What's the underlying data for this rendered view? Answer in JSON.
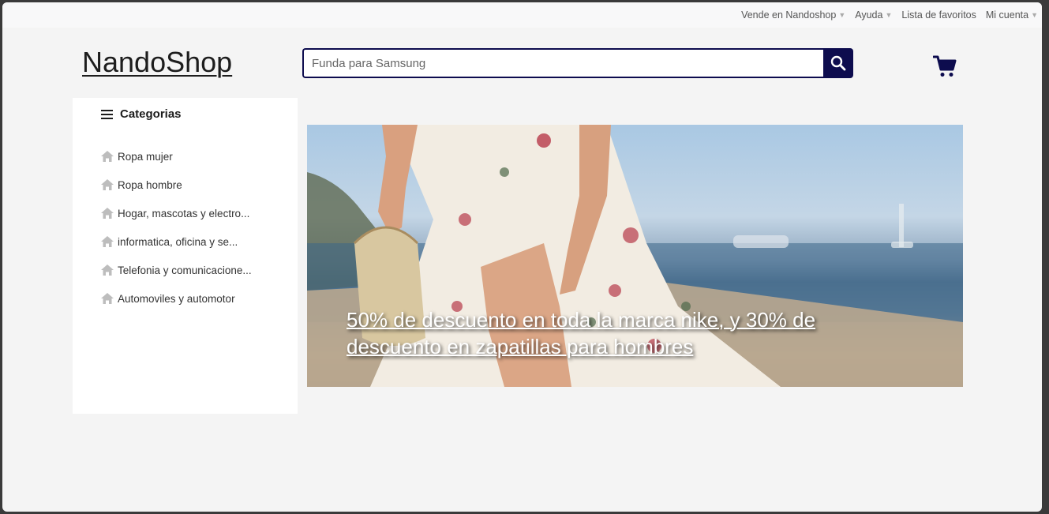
{
  "topbar": {
    "items": [
      {
        "label": "Vende en Nandoshop",
        "has_caret": true
      },
      {
        "label": "Ayuda",
        "has_caret": true
      },
      {
        "label": "Lista de favoritos",
        "has_caret": false
      },
      {
        "label": "Mi cuenta",
        "has_caret": true
      }
    ]
  },
  "header": {
    "logo": "NandoShop",
    "search": {
      "placeholder": "Funda para Samsung",
      "value": "",
      "button_icon": "search-icon"
    },
    "cart_icon": "shopping-cart-icon"
  },
  "sidebar": {
    "title": "Categorias",
    "title_icon": "menu-icon",
    "items": [
      {
        "label": "Ropa mujer",
        "icon": "home-icon"
      },
      {
        "label": "Ropa hombre",
        "icon": "home-icon"
      },
      {
        "label": "Hogar, mascotas y electro...",
        "icon": "home-icon"
      },
      {
        "label": "informatica, oficina y se...",
        "icon": "home-icon"
      },
      {
        "label": "Telefonia y comunicacione...",
        "icon": "home-icon"
      },
      {
        "label": "Automoviles y automotor",
        "icon": "home-icon"
      }
    ]
  },
  "banner": {
    "text": "50% de descuento en toda la marca nike, y 30% de descuento en zapatillas para hombres"
  },
  "colors": {
    "brand_navy": "#0d0c4e",
    "background": "#f4f4f4",
    "icon_gray": "#bdbdbd"
  }
}
